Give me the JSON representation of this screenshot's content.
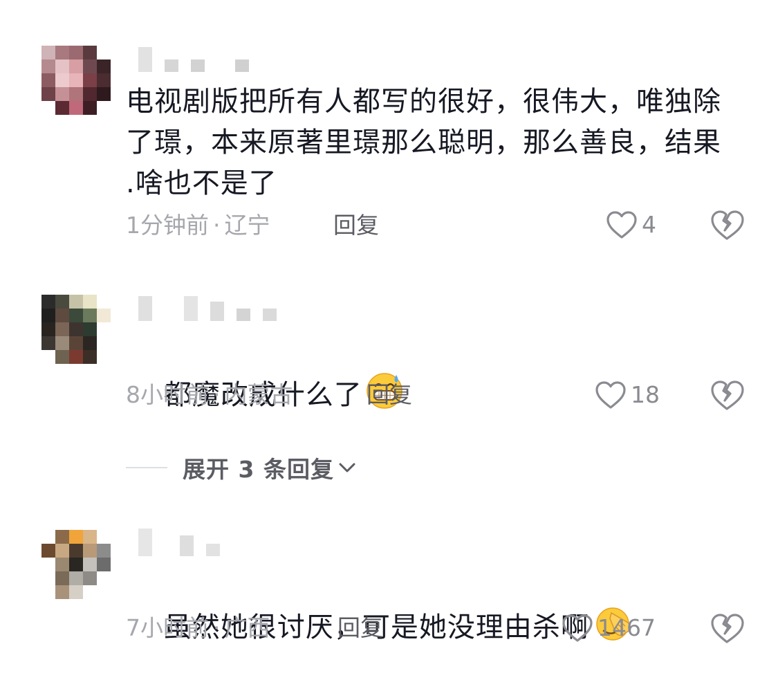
{
  "comments": [
    {
      "text": "电视剧版把所有人都写的很好，很伟大，唯独除了璟，本来原著里璟那么聪明，那么善良，结果      .啥也不是了",
      "time": "1分钟前",
      "separator": "·",
      "location": "辽宁",
      "reply_label": "回复",
      "likes": "4",
      "icons": {
        "like": "heart-outline-icon",
        "dislike": "broken-heart-icon"
      }
    },
    {
      "text": "都魔改成什么了",
      "emoji": "grinning-sweat-emoji",
      "time": "8小时前",
      "separator": "·",
      "location": "内蒙古",
      "reply_label": "回复",
      "likes": "18",
      "icons": {
        "like": "heart-outline-icon",
        "dislike": "broken-heart-icon"
      }
    },
    {
      "text": "虽然她很讨厌，可是她没理由杀啊",
      "emoji": "facepalm-emoji",
      "time": "7小时前",
      "separator": "·",
      "location": "广西",
      "reply_label": "回复",
      "likes": "1467",
      "icons": {
        "like": "heart-outline-icon",
        "dislike": "broken-heart-icon"
      }
    }
  ],
  "expand_replies": {
    "label": "展开 3 条回复",
    "icon": "chevron-down-icon"
  },
  "colors": {
    "text": "#161823",
    "meta": "#a6a7ad",
    "reply": "#5b5c63",
    "icon": "#8a8b91"
  }
}
